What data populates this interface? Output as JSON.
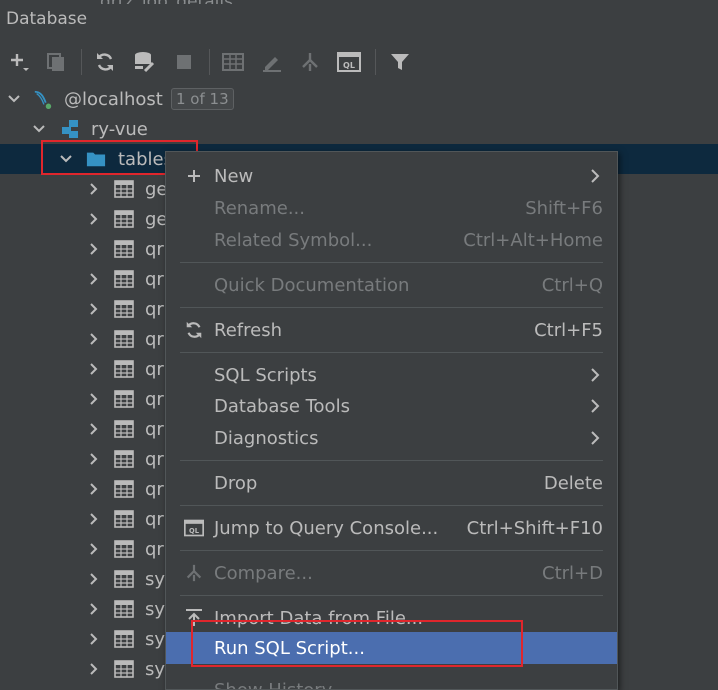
{
  "ghost_top": "qrtz_job_details",
  "panel": {
    "title": "Database"
  },
  "toolbar": {
    "icons": [
      "add-icon",
      "duplicate-icon",
      "refresh-icon",
      "properties-icon",
      "stop-icon",
      "table-icon",
      "edit-icon",
      "jump-icon",
      "query-console-icon",
      "filter-icon"
    ]
  },
  "tree": {
    "connection": {
      "label": "@localhost",
      "badge": "1 of 13"
    },
    "schema": {
      "label": "ry-vue"
    },
    "folder": {
      "label": "tables"
    },
    "tables": [
      "ge",
      "ge",
      "qr",
      "qr",
      "qr",
      "qr",
      "qr",
      "qr",
      "qr",
      "qr",
      "qr",
      "qr",
      "qr",
      "sy",
      "sy",
      "sy",
      "sy"
    ]
  },
  "menu": {
    "items": [
      {
        "label": "New",
        "shortcut": "",
        "submenu": true,
        "disabled": false,
        "icon": "plus-icon"
      },
      {
        "label": "Rename...",
        "shortcut": "Shift+F6",
        "submenu": false,
        "disabled": true,
        "icon": ""
      },
      {
        "label": "Related Symbol...",
        "shortcut": "Ctrl+Alt+Home",
        "submenu": false,
        "disabled": true,
        "icon": ""
      },
      {
        "label": "Quick Documentation",
        "shortcut": "Ctrl+Q",
        "submenu": false,
        "disabled": true,
        "icon": ""
      },
      {
        "label": "Refresh",
        "shortcut": "Ctrl+F5",
        "submenu": false,
        "disabled": false,
        "icon": "refresh-icon"
      },
      {
        "label": "SQL Scripts",
        "shortcut": "",
        "submenu": true,
        "disabled": false,
        "icon": ""
      },
      {
        "label": "Database Tools",
        "shortcut": "",
        "submenu": true,
        "disabled": false,
        "icon": ""
      },
      {
        "label": "Diagnostics",
        "shortcut": "",
        "submenu": true,
        "disabled": false,
        "icon": ""
      },
      {
        "label": "Drop",
        "shortcut": "Delete",
        "submenu": false,
        "disabled": false,
        "icon": ""
      },
      {
        "label": "Jump to Query Console...",
        "shortcut": "Ctrl+Shift+F10",
        "submenu": false,
        "disabled": false,
        "icon": "query-console-icon"
      },
      {
        "label": "Compare...",
        "shortcut": "Ctrl+D",
        "submenu": false,
        "disabled": true,
        "icon": "compare-icon"
      },
      {
        "label": "Import Data from File...",
        "shortcut": "",
        "submenu": false,
        "disabled": false,
        "icon": "import-icon"
      },
      {
        "label": "Run SQL Script...",
        "shortcut": "",
        "submenu": false,
        "disabled": false,
        "icon": "",
        "active": true
      },
      {
        "label": "Show History",
        "shortcut": "",
        "submenu": false,
        "disabled": true,
        "icon": ""
      }
    ]
  },
  "colors": {
    "background": "#3c3f41",
    "selection": "#0d293e",
    "menu_active": "#4b6eaf",
    "highlight_red": "#e0262c",
    "folder_blue": "#3592c4"
  }
}
